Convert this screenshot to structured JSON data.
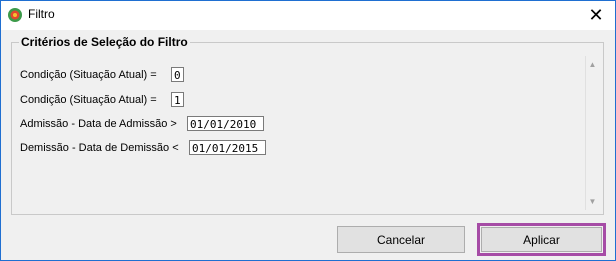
{
  "window": {
    "title": "Filtro",
    "close_glyph": "✕"
  },
  "group": {
    "title": "Critérios de Seleção do Filtro"
  },
  "rows": [
    {
      "label": "Condição (Situação Atual) =",
      "value": "0"
    },
    {
      "label": "Condição (Situação Atual) =",
      "value": "1"
    },
    {
      "label": "Admissão - Data de Admissão >",
      "value": "01/01/2010"
    },
    {
      "label": "Demissão - Data de Demissão <",
      "value": "01/01/2015"
    }
  ],
  "buttons": {
    "cancel": "Cancelar",
    "apply": "Aplicar"
  },
  "icons": {
    "app": "filter-app-icon",
    "scroll_up": "scroll-up-icon",
    "scroll_down": "scroll-down-icon"
  },
  "colors": {
    "highlight": "#a64ca6",
    "window_border": "#1f6fd1"
  }
}
